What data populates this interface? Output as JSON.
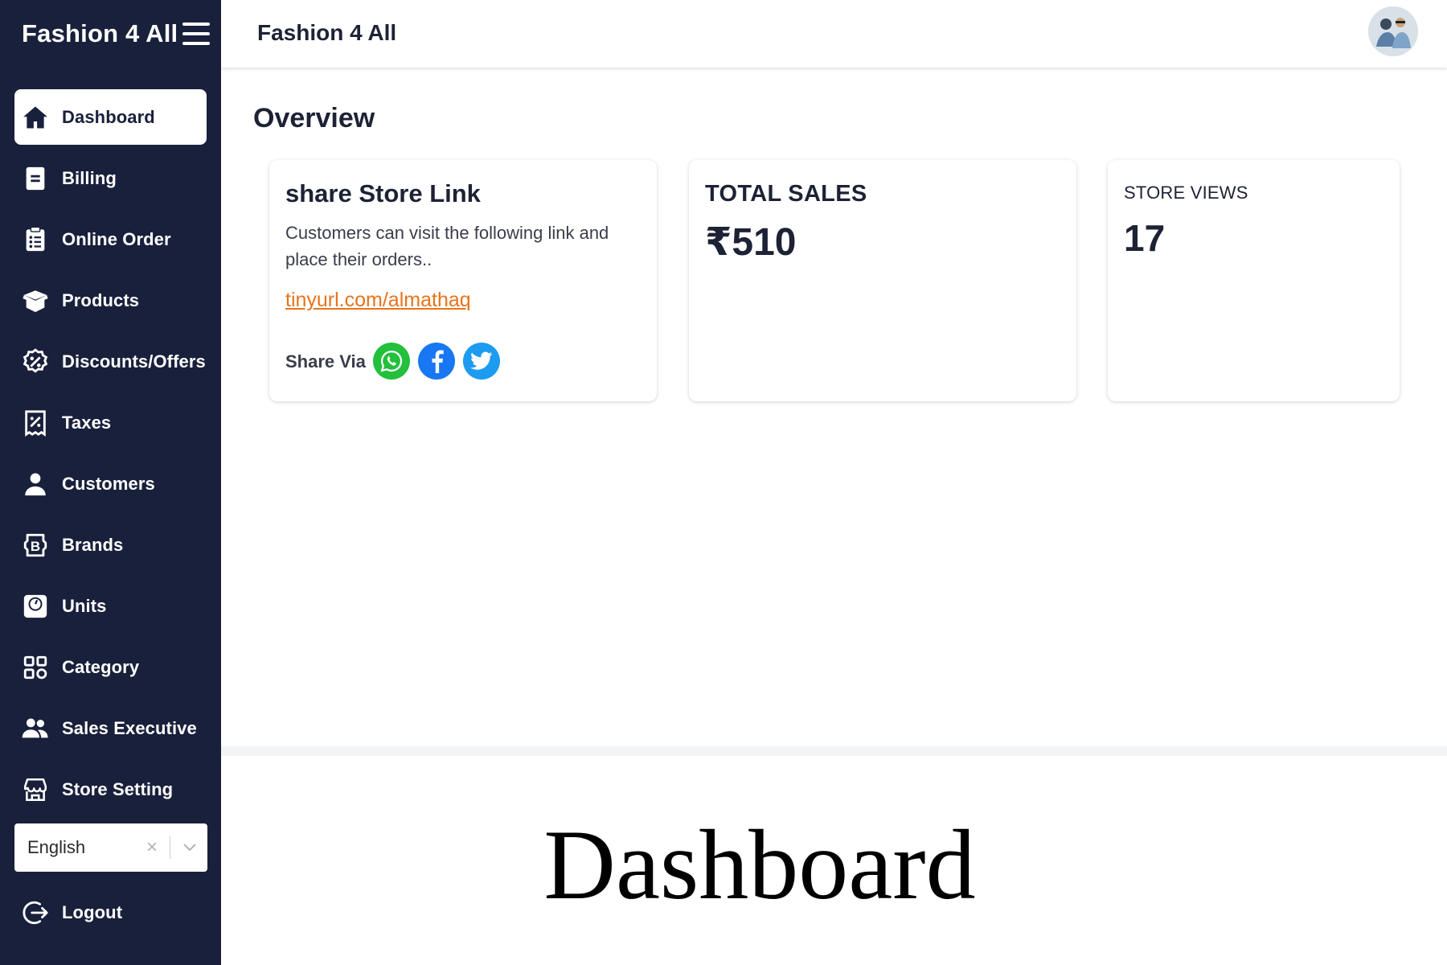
{
  "app": {
    "brand": "Fashion 4 All",
    "topbar_title": "Fashion 4 All"
  },
  "colors": {
    "sidebar_bg": "#19203b",
    "accent_link": "#e8731b",
    "whatsapp": "#22c03c",
    "facebook": "#1877f2",
    "twitter": "#1d9bf0"
  },
  "sidebar": {
    "items": [
      {
        "label": "Dashboard",
        "icon": "home-icon",
        "active": true
      },
      {
        "label": "Billing",
        "icon": "billing-icon",
        "active": false
      },
      {
        "label": "Online Order",
        "icon": "clipboard-icon",
        "active": false
      },
      {
        "label": "Products",
        "icon": "box-icon",
        "active": false
      },
      {
        "label": "Discounts/Offers",
        "icon": "discount-badge-icon",
        "active": false
      },
      {
        "label": "Taxes",
        "icon": "tax-receipt-icon",
        "active": false
      },
      {
        "label": "Customers",
        "icon": "user-icon",
        "active": false
      },
      {
        "label": "Brands",
        "icon": "brand-b-icon",
        "active": false
      },
      {
        "label": "Units",
        "icon": "scale-icon",
        "active": false
      },
      {
        "label": "Category",
        "icon": "category-grid-icon",
        "active": false
      },
      {
        "label": "Sales Executive",
        "icon": "users-icon",
        "active": false
      },
      {
        "label": "Store Setting",
        "icon": "store-icon",
        "active": false
      }
    ],
    "language": {
      "selected": "English",
      "clear": "×"
    },
    "logout_label": "Logout"
  },
  "main": {
    "heading": "Overview",
    "share_card": {
      "title": "share Store Link",
      "description": "Customers can visit the following link and place their orders..",
      "link": "tinyurl.com/almathaq",
      "share_via": "Share Via"
    },
    "sales_card": {
      "title": "TOTAL SALES",
      "value": "₹510"
    },
    "views_card": {
      "title": "STORE VIEWS",
      "value": "17"
    }
  },
  "caption": "Dashboard"
}
